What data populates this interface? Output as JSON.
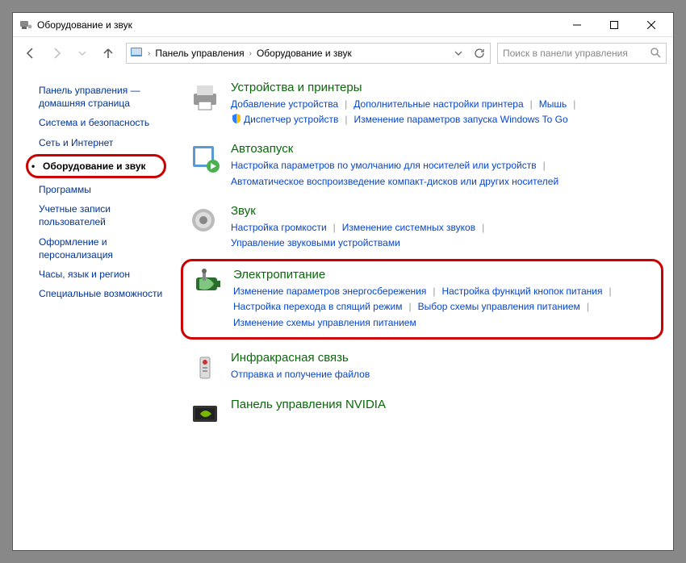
{
  "window": {
    "title": "Оборудование и звук"
  },
  "breadcrumb": {
    "root": "Панель управления",
    "current": "Оборудование и звук"
  },
  "search": {
    "placeholder": "Поиск в панели управления"
  },
  "sidebar": {
    "items": [
      {
        "label": "Панель управления — домашняя страница"
      },
      {
        "label": "Система и безопасность"
      },
      {
        "label": "Сеть и Интернет"
      },
      {
        "label": "Оборудование и звук",
        "active": true
      },
      {
        "label": "Программы"
      },
      {
        "label": "Учетные записи пользователей"
      },
      {
        "label": "Оформление и персонализация"
      },
      {
        "label": "Часы, язык и регион"
      },
      {
        "label": "Специальные возможности"
      }
    ]
  },
  "categories": [
    {
      "title": "Устройства и принтеры",
      "icon": "printer",
      "links": [
        {
          "label": "Добавление устройства"
        },
        {
          "label": "Дополнительные настройки принтера"
        },
        {
          "label": "Мышь"
        },
        {
          "label": "Диспетчер устройств",
          "shield": true
        },
        {
          "label": "Изменение параметров запуска Windows To Go"
        }
      ]
    },
    {
      "title": "Автозапуск",
      "icon": "autoplay",
      "links": [
        {
          "label": "Настройка параметров по умолчанию для носителей или устройств"
        },
        {
          "label": "Автоматическое воспроизведение компакт-дисков или других носителей"
        }
      ]
    },
    {
      "title": "Звук",
      "icon": "sound",
      "links": [
        {
          "label": "Настройка громкости"
        },
        {
          "label": "Изменение системных звуков"
        },
        {
          "label": "Управление звуковыми устройствами"
        }
      ]
    },
    {
      "title": "Электропитание",
      "icon": "power",
      "highlight": true,
      "links": [
        {
          "label": "Изменение параметров энергосбережения"
        },
        {
          "label": "Настройка функций кнопок питания"
        },
        {
          "label": "Настройка перехода в спящий режим"
        },
        {
          "label": "Выбор схемы управления питанием"
        },
        {
          "label": "Изменение схемы управления питанием"
        }
      ]
    },
    {
      "title": "Инфракрасная связь",
      "icon": "infrared",
      "links": [
        {
          "label": "Отправка и получение файлов"
        }
      ]
    },
    {
      "title": "Панель управления NVIDIA",
      "icon": "nvidia",
      "links": []
    }
  ]
}
